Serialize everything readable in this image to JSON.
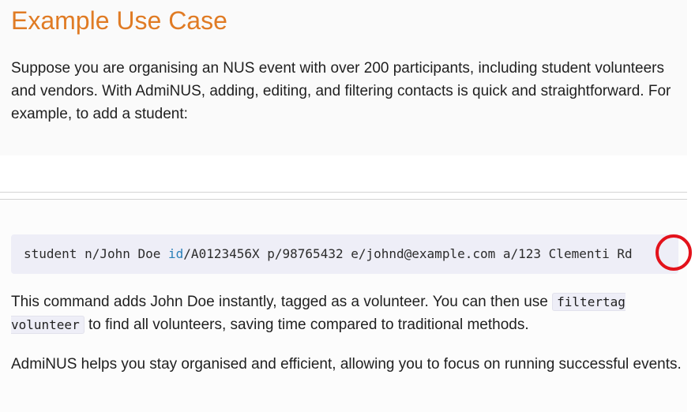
{
  "section": {
    "heading": "Example Use Case",
    "intro": "Suppose you are organising an NUS event with over 200 participants, including student volunteers and vendors. With AdmiNUS, adding, editing, and filtering contacts is quick and straightforward. For example, to add a student:"
  },
  "code_block": {
    "before_keyword": "student n/John Doe ",
    "keyword": "id",
    "after_keyword": "/A0123456X p/98765432 e/johnd@example.com a/123 Clementi Rd",
    "keyword_color": "#2a7fb8"
  },
  "paragraph1": {
    "text_before": "This command adds John Doe instantly, tagged as a volunteer. You can then use ",
    "inline_code": "filtertag volunteer",
    "text_after": " to find all volunteers, saving time compared to traditional methods."
  },
  "paragraph2": {
    "text": "AdmiNUS helps you stay organised and efficient, allowing you to focus on running successful events."
  },
  "colors": {
    "heading": "#e07b24",
    "annotation_circle": "#e3121b",
    "code_background": "#eeeef7"
  }
}
